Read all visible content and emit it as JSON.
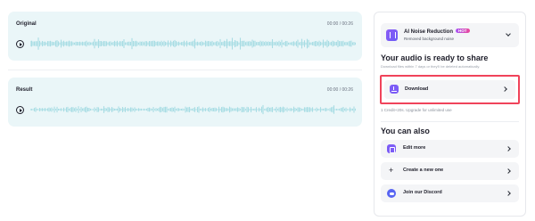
{
  "players": {
    "original": {
      "title": "Original",
      "time": "00:00 / 00:26"
    },
    "result": {
      "title": "Result",
      "time": "00:00 / 00:26"
    }
  },
  "panel": {
    "tool": {
      "name": "AI Noise Reduction",
      "badge": "HOT",
      "description": "Removed background noise"
    },
    "share_title": "Your audio is ready to share",
    "share_note": "Download files within 7 days or they'll be deleted automatically.",
    "download_label": "Download",
    "credit_note": "1 Credit+20s. Upgrade for unlimited use",
    "also_title": "You can also",
    "actions": [
      {
        "label": "Edit more",
        "icon": "edit-icon"
      },
      {
        "label": "Create a new one",
        "icon": "plus-icon"
      },
      {
        "label": "Join our Discord",
        "icon": "discord-icon"
      }
    ]
  },
  "colors": {
    "waveform": "#a8dde4",
    "card_background": "#eaf6f8",
    "accent": "#7c5cf6",
    "highlight_border": "#f0435a"
  }
}
